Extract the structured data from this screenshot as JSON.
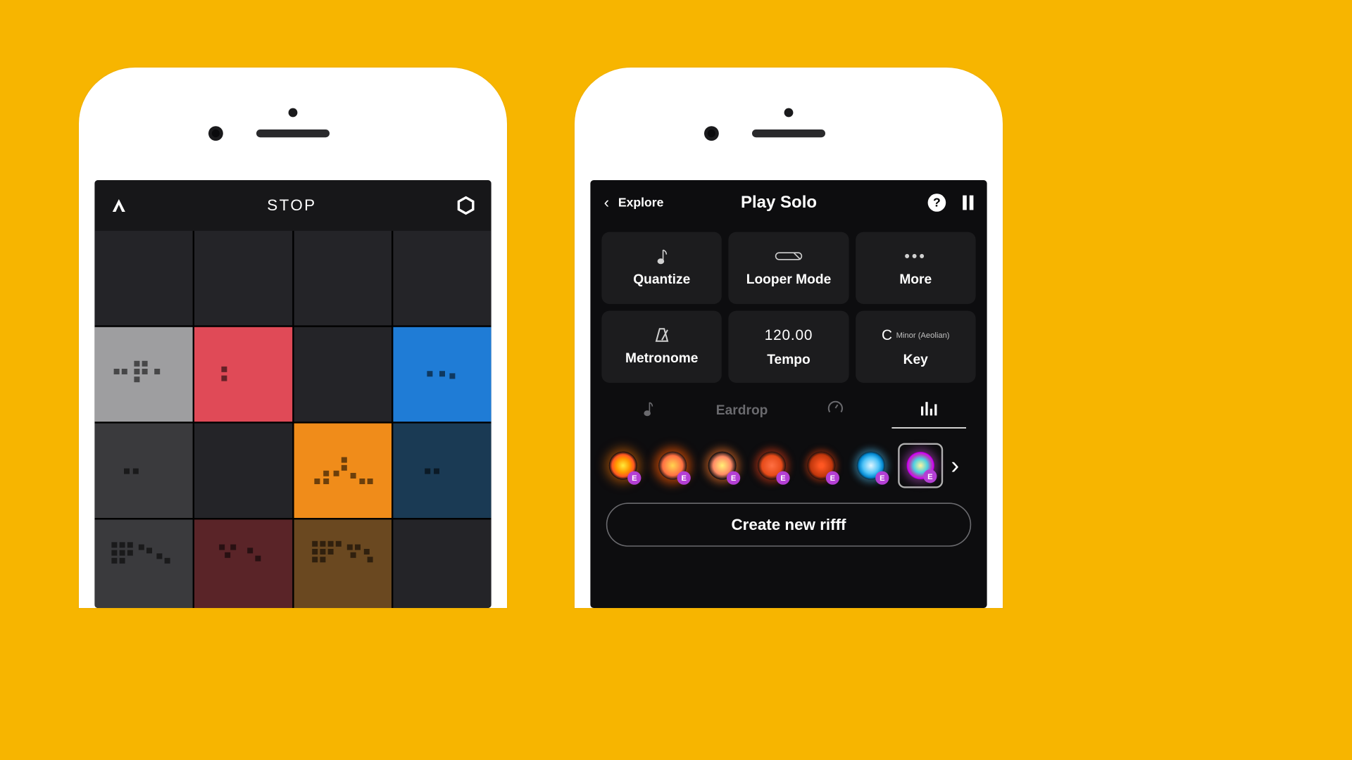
{
  "left": {
    "title": "STOP"
  },
  "right": {
    "back_label": "Explore",
    "title": "Play Solo",
    "tiles": {
      "quantize": "Quantize",
      "looper": "Looper Mode",
      "more": "More",
      "metronome": "Metronome",
      "tempo_value": "120.00",
      "tempo": "Tempo",
      "key_note": "C",
      "key_mode": "Minor (Aeolian)",
      "key": "Key"
    },
    "tabs": {
      "eardrop": "Eardrop"
    },
    "preset_badge": "E",
    "cta": "Create new rifff"
  }
}
